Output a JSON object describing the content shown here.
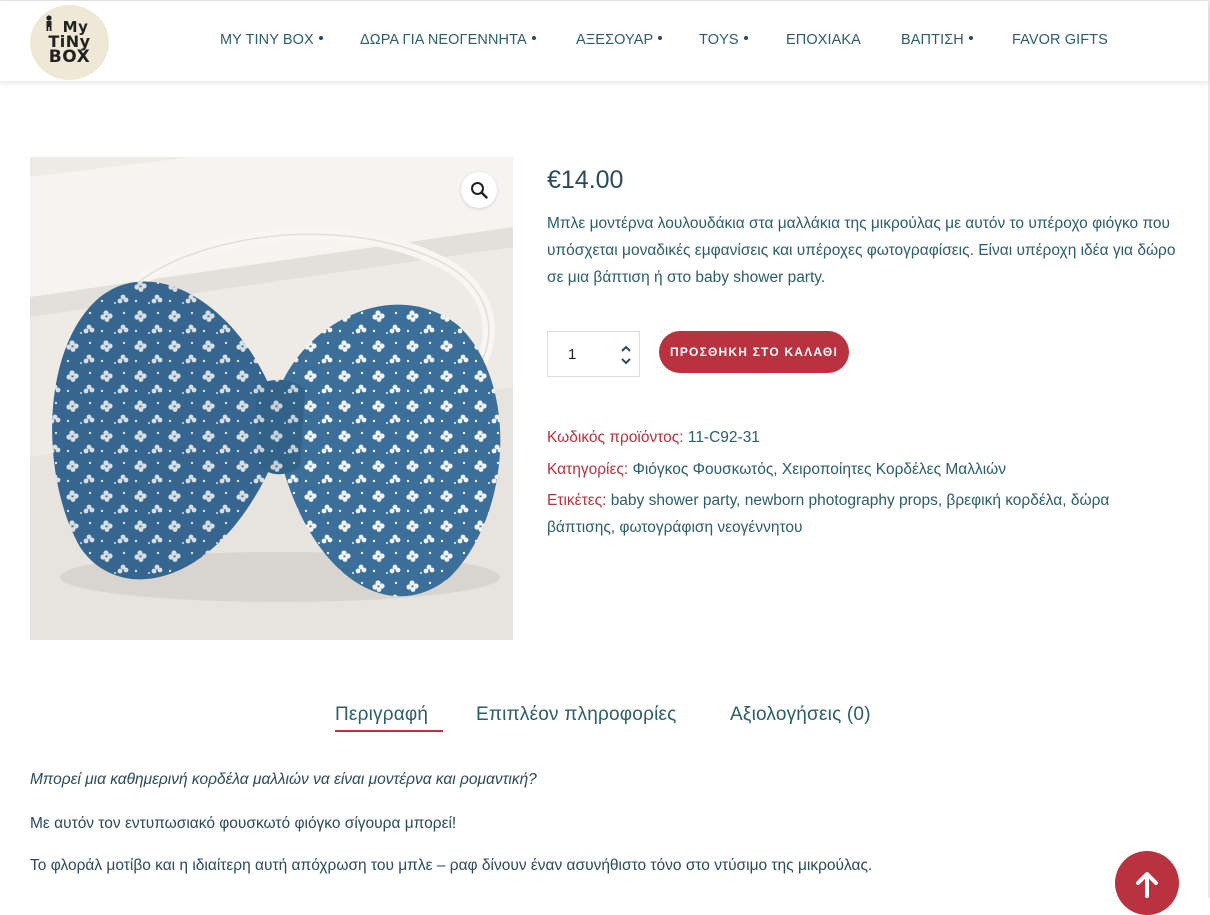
{
  "brand": {
    "logo_text": [
      "My",
      "TiNy",
      "BOX"
    ]
  },
  "nav": {
    "items": [
      {
        "label": "MY TINY BOX",
        "has_submenu": true
      },
      {
        "label": "ΔΩΡΑ ΓΙΑ ΝΕΟΓΕΝΝΗΤΑ",
        "has_submenu": true
      },
      {
        "label": "ΑΞΕΣΟΥΑΡ",
        "has_submenu": true
      },
      {
        "label": "TOYS",
        "has_submenu": true
      },
      {
        "label": "ΕΠΟΧΙΑΚΑ",
        "has_submenu": false
      },
      {
        "label": "ΒΑΠΤΙΣΗ",
        "has_submenu": true
      },
      {
        "label": "FAVOR GIFTS",
        "has_submenu": false
      }
    ]
  },
  "product": {
    "image_icon": "zoom-icon",
    "price": "€14.00",
    "description": "Μπλε μοντέρνα λουλουδάκια στα μαλλάκια της μικρούλας με αυτόν το υπέροχο φιόγκο που υπόσχεται μοναδικές εμφανίσεις και υπέροχες φωτογραφίσεις.  Είναι υπέροχη ιδέα για δώρο σε μια βάπτιση ή στο baby shower party.",
    "quantity": "1",
    "add_to_cart_label": "ΠΡΟΣΘΗΚΗ ΣΤΟ ΚΑΛΑΘΙ",
    "meta": {
      "sku_label": "Κωδικός προϊόντος:",
      "sku_value": "11-C92-31",
      "categories_label": "Κατηγορίες:",
      "categories_value": "Φιόγκος Φουσκωτός, Χειροποίητες Κορδέλες Μαλλιών",
      "tags_label": "Ετικέτες:",
      "tags_value": "baby shower party, newborn photography props, βρεφική κορδέλα, δώρα βάπτισης, φωτογράφιση νεογέννητου"
    }
  },
  "tabs": [
    {
      "label": "Περιγραφή",
      "active": true
    },
    {
      "label": "Επιπλέον πληροφορίες",
      "active": false
    },
    {
      "label": "Αξιολογήσεις (0)",
      "active": false
    }
  ],
  "tab_content": {
    "p1": "Μπορεί μια καθημερινή κορδέλα μαλλιών  να είναι μοντέρνα και  ρομαντική?",
    "p2": "Με αυτόν τον εντυπωσιακό φουσκωτό φιόγκο σίγουρα μπορεί!",
    "p3": "Το φλοράλ μοτίβο και η ιδιαίτερη αυτή απόχρωση του μπλε – ραφ δίνουν έναν ασυνήθιστο τόνο στο ντύσιμο της μικρούλας."
  },
  "colors": {
    "accent": "#b8323f",
    "text": "#2b4a5c",
    "fabric": "#3b6e98"
  },
  "scroll_top_icon": "arrow-up-icon"
}
